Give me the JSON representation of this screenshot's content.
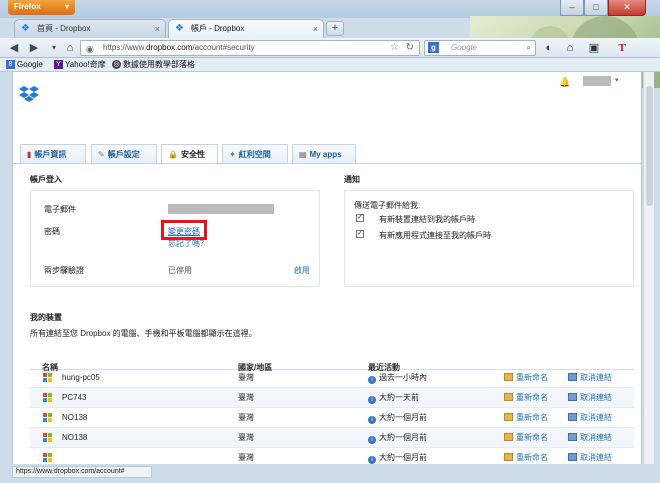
{
  "window": {
    "app_button": "Firefox",
    "controls": [
      "–",
      "□",
      "✕"
    ]
  },
  "tabs": [
    {
      "label": "首頁 - Dropbox",
      "active": false
    },
    {
      "label": "帳戶 - Dropbox",
      "active": true
    }
  ],
  "navbar": {
    "url_prefix": "https://www.",
    "url_domain": "dropbox.com",
    "url_path": "/account#security",
    "search_placeholder": "Google",
    "search_engine_letter": "g"
  },
  "bookmarks": [
    {
      "label": "Google",
      "icon": "g-icon"
    },
    {
      "label": "Yahoo!奇摩",
      "icon": "yahoo-icon"
    },
    {
      "label": "數據使用教學部落格",
      "icon": "blog-icon"
    }
  ],
  "page": {
    "tabs": [
      {
        "label": "帳戶資訊",
        "icon": "chart-icon",
        "active": false
      },
      {
        "label": "帳戶設定",
        "icon": "wrench-icon",
        "active": false
      },
      {
        "label": "安全性",
        "icon": "lock-icon",
        "active": true
      },
      {
        "label": "紅利空間",
        "icon": "gift-icon",
        "active": false
      },
      {
        "label": "My apps",
        "icon": "apps-icon",
        "active": false
      }
    ],
    "login": {
      "title": "帳戶登入",
      "email_label": "電子郵件",
      "password_label": "密碼",
      "change_password": "變更密碼",
      "forgot_password": "忘記了嗎？",
      "two_step_label": "兩步驟驗證",
      "two_step_status": "已停用",
      "enable_link": "啟用"
    },
    "notifications": {
      "title": "通知",
      "subtitle": "傳送電子郵件給我:",
      "items": [
        {
          "label": "有新裝置連結到我的帳戶時",
          "checked": true
        },
        {
          "label": "有新應用程式連接至我的帳戶時",
          "checked": true
        }
      ]
    },
    "devices": {
      "title": "我的裝置",
      "description": "所有連結至您 Dropbox 的電腦、手機和平板電腦都顯示在這裡。",
      "columns": [
        "名稱",
        "國家/地區",
        "最近活動"
      ],
      "rename": "重新命名",
      "unlink": "取消連結",
      "rows": [
        {
          "name": "hung-pc05",
          "country": "臺灣",
          "activity": "過去一小時內"
        },
        {
          "name": "PC743",
          "country": "臺灣",
          "activity": "大約一天前"
        },
        {
          "name": "NO138",
          "country": "臺灣",
          "activity": "大約一個月前"
        },
        {
          "name": "NO138",
          "country": "臺灣",
          "activity": "大約一個月前"
        },
        {
          "name": "",
          "country": "臺灣",
          "activity": "大約一個月前"
        }
      ]
    }
  },
  "status_bar": "https://www.dropbox.com/account#",
  "colors": {
    "accent": "#1f6fc5",
    "highlight_red": "#e8141b",
    "firefox_orange": "#dc6c10"
  }
}
